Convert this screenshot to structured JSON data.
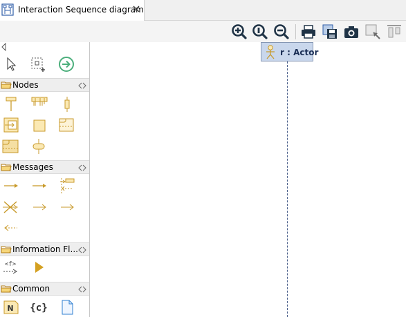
{
  "tab": {
    "title": "Interaction Sequence diagram"
  },
  "toolbar": {
    "buttons": [
      "zoom-in-icon",
      "zoom-reset-icon",
      "zoom-out-icon",
      "print-icon",
      "save-image-icon",
      "snapshot-icon",
      "select-area-icon",
      "align-top-icon"
    ]
  },
  "palette": {
    "tools": [
      "select-arrow-icon",
      "marquee-select-icon",
      "go-to-icon"
    ],
    "groups": [
      {
        "label": "Nodes"
      },
      {
        "label": "Messages"
      },
      {
        "label": "Information Fl..."
      },
      {
        "label": "Common"
      }
    ]
  },
  "canvas": {
    "lifeline": {
      "label": "r : Actor"
    }
  },
  "colors": {
    "accent_gold": "#c89a2b",
    "lifeline_fill": "#c9d7ec",
    "go_green": "#4caf7c",
    "zoom_navy": "#1f3346"
  }
}
